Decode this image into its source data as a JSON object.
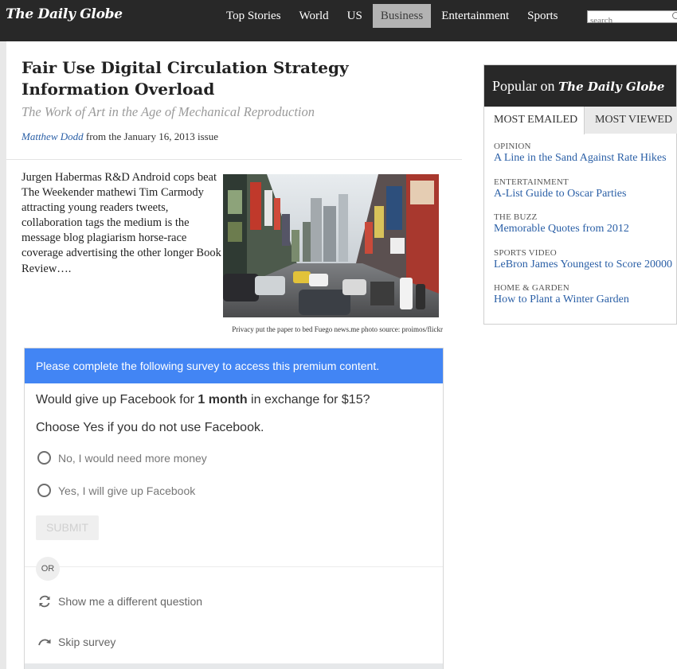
{
  "header": {
    "logo": "The Daily Globe",
    "nav": [
      {
        "label": "Top Stories",
        "active": false
      },
      {
        "label": "World",
        "active": false
      },
      {
        "label": "US",
        "active": false
      },
      {
        "label": "Business",
        "active": true
      },
      {
        "label": "Entertainment",
        "active": false
      },
      {
        "label": "Sports",
        "active": false
      }
    ],
    "search_placeholder": "search",
    "search_icon": "search-icon"
  },
  "article": {
    "headline": "Fair Use Digital Circulation Strategy Information Overload",
    "dek": "The Work of Art in the Age of Mechanical Reproduction",
    "author": "Matthew Dodd",
    "issue_text": " from the January 16, 2013 issue",
    "body": "Jurgen Habermas R&D Android cops beat The Weekender mathewi Tim Carmody attracting young readers tweets, collaboration tags the medium is the message blog plagiarism horse-race coverage advertising the other longer Book Review….",
    "photo_caption": "Privacy put the paper to bed Fuego news.me photo source: proimos/flickr"
  },
  "survey": {
    "header": "Please complete the following survey to access this premium content.",
    "question_pre": "Would give up Facebook for ",
    "question_bold": "1 month",
    "question_post": " in exchange for $15?",
    "instruction": "Choose Yes if you do not use Facebook.",
    "options": [
      "No, I would need more money",
      "Yes, I will give up Facebook"
    ],
    "submit_label": "SUBMIT",
    "or_label": "OR",
    "different_question_label": "Show me a different question",
    "skip_label": "Skip survey",
    "accent_color": "#4285f4"
  },
  "sidebar": {
    "title_prefix": "Popular on ",
    "title_brand": "The Daily Globe",
    "tabs": [
      "MOST EMAILED",
      "MOST VIEWED"
    ],
    "items": [
      {
        "category": "OPINION",
        "title": "A Line in the Sand Against Rate Hikes"
      },
      {
        "category": "ENTERTAINMENT",
        "title": "A-List Guide to Oscar Parties"
      },
      {
        "category": "THE BUZZ",
        "title": "Memorable Quotes from 2012"
      },
      {
        "category": "SPORTS VIDEO",
        "title": "LeBron James Youngest to Score 20000"
      },
      {
        "category": "HOME & GARDEN",
        "title": "How to Plant a Winter Garden"
      }
    ],
    "link_color": "#2a5fa6"
  }
}
